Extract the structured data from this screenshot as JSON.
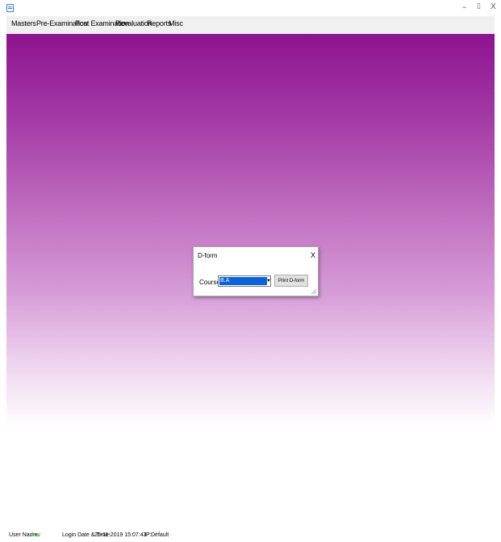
{
  "window": {
    "controls": {
      "minimize": "–",
      "restore": "▯",
      "close": "X"
    }
  },
  "menu": {
    "items": [
      "Masters",
      "Pre-Examination",
      "Post Examination",
      "Revaluation",
      "Reports",
      "Misc"
    ]
  },
  "dialog": {
    "title": "D-form",
    "close": "X",
    "course_label": "Course",
    "course_value": "B.A",
    "print_button": "Print D-form"
  },
  "status": {
    "user_name_label": "User Name:",
    "user_name": "dnw",
    "login_label": "Login Date & Time:",
    "login_datetime": "25-11-2019 15:07:43",
    "ip_label": "IP:",
    "ip": "Default"
  },
  "colors": {
    "workspace_top": "#8e1390",
    "workspace_bottom": "#ffffff",
    "selection": "#0a64d8",
    "user_name": "#1c9a1c"
  },
  "icons": [
    "app-icon",
    "dropdown-arrow-icon",
    "resize-grip-icon"
  ]
}
